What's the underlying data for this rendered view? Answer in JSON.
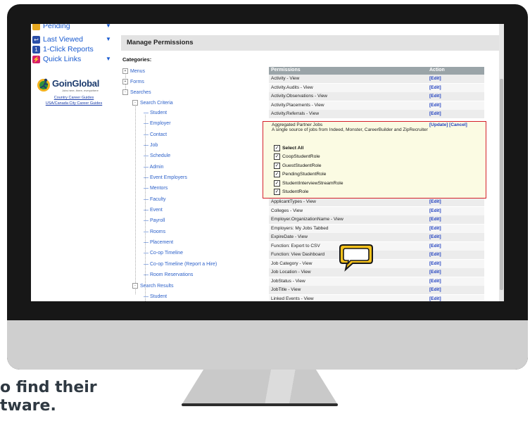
{
  "nav": {
    "items": [
      {
        "label": "Pending",
        "icon": "pending-icon",
        "color": "#e7a81f"
      },
      {
        "label": "Last Viewed",
        "icon": "back-arrow-icon",
        "color": "#2b4fa8"
      },
      {
        "label": "1-Click Reports",
        "icon": "reports-icon",
        "color": "#2b4fa8"
      },
      {
        "label": "Quick Links",
        "icon": "quick-links-icon",
        "color": "#d6206b"
      }
    ],
    "logo_text": "GoinGlobal",
    "logo_tag": "Jobs here, there, everywhere",
    "links": [
      "Country Career Guides",
      "USA/Canada City Career Guides"
    ]
  },
  "header": {
    "title": "Manage Permissions"
  },
  "categories_label": "Categories:",
  "tree": [
    {
      "label": "Menus",
      "level": 0,
      "pm": "+"
    },
    {
      "label": "Forms",
      "level": 0,
      "pm": "+"
    },
    {
      "label": "Searches",
      "level": 0,
      "pm": "-"
    },
    {
      "label": "Search Criteria",
      "level": 1,
      "pm": "-"
    },
    {
      "label": "Student",
      "level": 2
    },
    {
      "label": "Employer",
      "level": 2
    },
    {
      "label": "Contact",
      "level": 2
    },
    {
      "label": "Job",
      "level": 2
    },
    {
      "label": "Schedule",
      "level": 2
    },
    {
      "label": "Admin",
      "level": 2
    },
    {
      "label": "Event Employers",
      "level": 2
    },
    {
      "label": "Mentors",
      "level": 2
    },
    {
      "label": "Faculty",
      "level": 2
    },
    {
      "label": "Event",
      "level": 2
    },
    {
      "label": "Payroll",
      "level": 2
    },
    {
      "label": "Rooms",
      "level": 2
    },
    {
      "label": "Placement",
      "level": 2
    },
    {
      "label": "Co-op Timeline",
      "level": 2
    },
    {
      "label": "Co-op Timeline (Report a Hire)",
      "level": 2
    },
    {
      "label": "Room Reservations",
      "level": 2
    },
    {
      "label": "Search Results",
      "level": 1,
      "pm": "-"
    },
    {
      "label": "Student",
      "level": 2
    }
  ],
  "table": {
    "headers": {
      "permissions": "Permissions",
      "action": "Action"
    },
    "rows_top": [
      {
        "p": "Activity - View",
        "a": "[Edit]"
      },
      {
        "p": "Activity.Audits - View",
        "a": "[Edit]"
      },
      {
        "p": "Activity.Observations - View",
        "a": "[Edit]"
      },
      {
        "p": "Activity.Placements - View",
        "a": "[Edit]"
      },
      {
        "p": "Activity.Referrals - View",
        "a": "[Edit]"
      }
    ],
    "edit": {
      "title": "Aggregated Partner Jobs",
      "description": "A single source of jobs from Indeed, Monster, CareerBuilder and ZipRecruiter",
      "actions": "[Update] [Cancel]",
      "options": [
        {
          "label": "Select All",
          "bold": true
        },
        {
          "label": "CoopStudentRole"
        },
        {
          "label": "GuestStudentRole"
        },
        {
          "label": "PendingStudentRole"
        },
        {
          "label": "StudentInterviewStreamRole"
        },
        {
          "label": "StudentRole"
        }
      ]
    },
    "rows_bottom": [
      {
        "p": "ApplicantTypes - View",
        "a": "[Edit]"
      },
      {
        "p": "Colleges - View",
        "a": "[Edit]"
      },
      {
        "p": "Employer.OrganizationName - View",
        "a": "[Edit]"
      },
      {
        "p": "Employers: My Jobs Tabbed",
        "a": "[Edit]"
      },
      {
        "p": "ExpireDate - View",
        "a": "[Edit]"
      },
      {
        "p": "Function: Export to CSV",
        "a": "[Edit]"
      },
      {
        "p": "Function: View Dashboard",
        "a": "[Edit]"
      },
      {
        "p": "Job Category - View",
        "a": "[Edit]"
      },
      {
        "p": "Job Location - View",
        "a": "[Edit]"
      },
      {
        "p": "JobStatus - View",
        "a": "[Edit]"
      },
      {
        "p": "JobTitle - View",
        "a": "[Edit]"
      },
      {
        "p": "Linked Events - View",
        "a": "[Edit]"
      }
    ]
  },
  "bottom_text": {
    "line1": "o find their",
    "line2": "tware."
  },
  "colors": {
    "accent": "#1f3fbf",
    "highlight_border": "#d4202a",
    "bubble": "#f6c21b"
  }
}
